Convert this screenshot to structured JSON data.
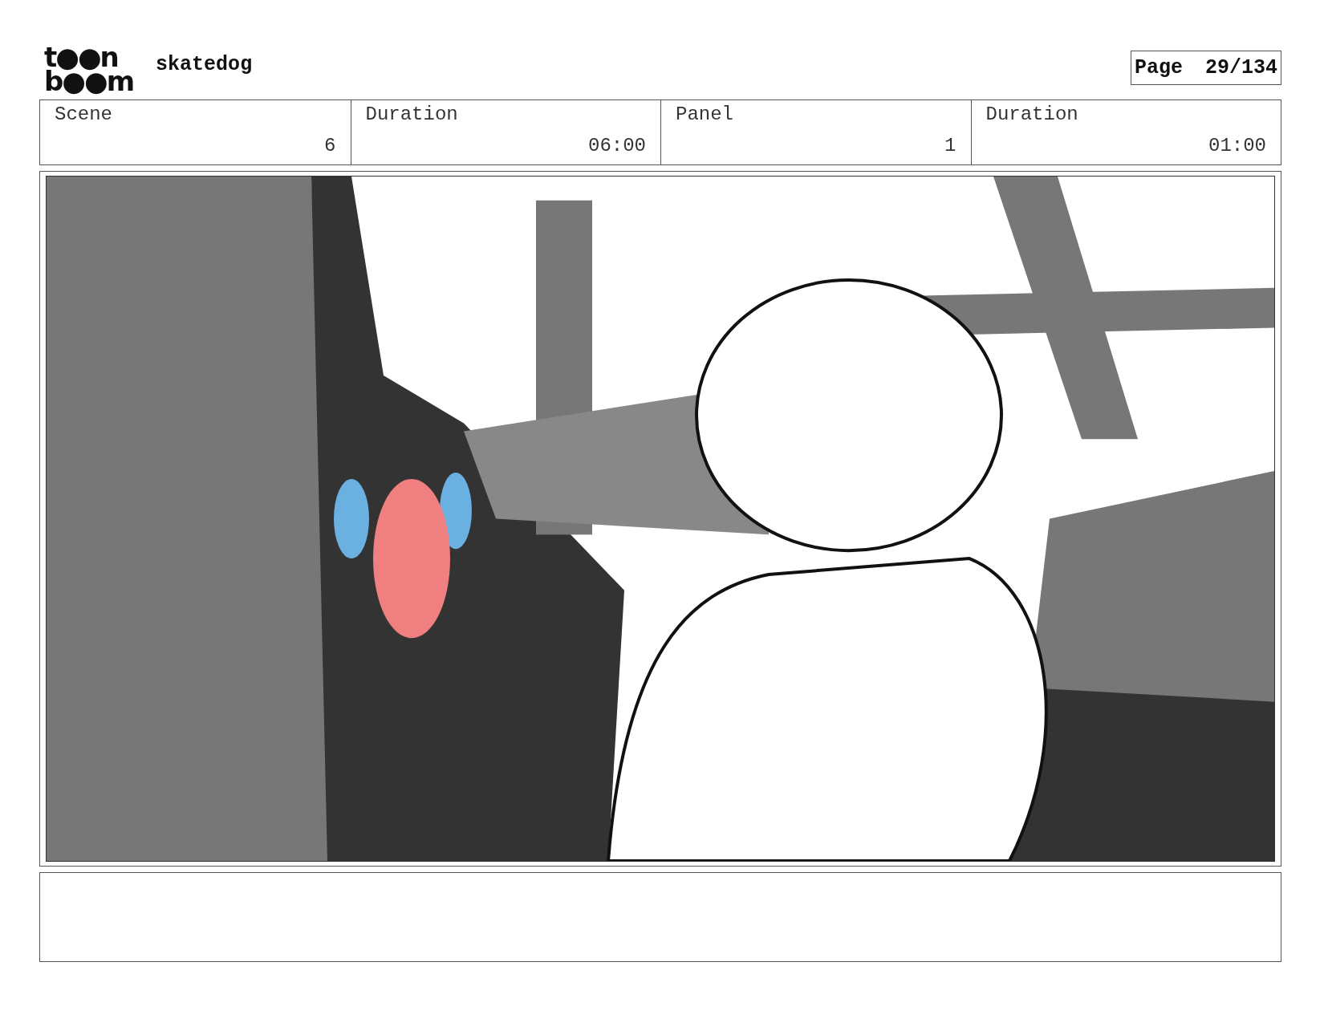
{
  "logo": {
    "lines": [
      "t●●n",
      "b●●m"
    ]
  },
  "project": {
    "title": "skatedog"
  },
  "page": {
    "label": "Page",
    "number": "29/134"
  },
  "fields": [
    {
      "label": "Scene",
      "value": "6"
    },
    {
      "label": "Duration",
      "value": "06:00"
    },
    {
      "label": "Panel",
      "value": "1"
    },
    {
      "label": "Duration",
      "value": "01:00"
    }
  ]
}
